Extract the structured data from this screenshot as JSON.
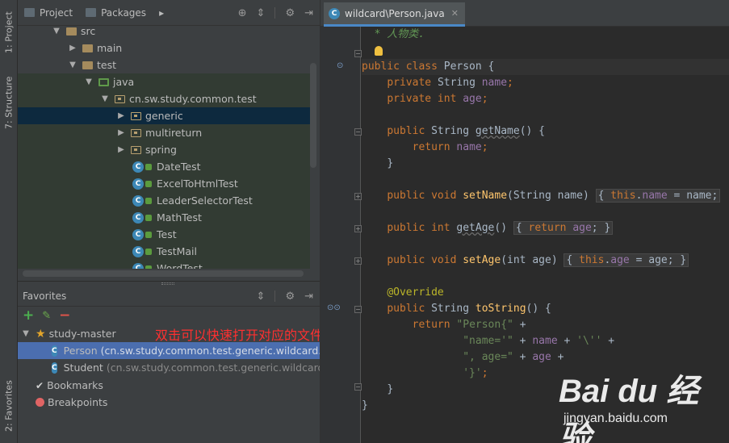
{
  "left_strip": {
    "project_tab": "1: Project",
    "structure_tab": "7: Structure",
    "favorites_tab": "2: Favorites"
  },
  "project_panel": {
    "tabs": [
      "Project",
      "Packages"
    ],
    "tree": [
      {
        "label": "src",
        "kind": "folder",
        "expanded": true
      },
      {
        "label": "main",
        "kind": "folder",
        "expanded": false
      },
      {
        "label": "test",
        "kind": "folder",
        "expanded": true
      },
      {
        "label": "java",
        "kind": "test-root",
        "expanded": true
      },
      {
        "label": "cn.sw.study.common.test",
        "kind": "package",
        "expanded": true
      },
      {
        "label": "generic",
        "kind": "package",
        "expanded": false
      },
      {
        "label": "multireturn",
        "kind": "package",
        "expanded": false
      },
      {
        "label": "spring",
        "kind": "package",
        "expanded": false
      },
      {
        "label": "DateTest",
        "kind": "class"
      },
      {
        "label": "ExcelToHtmlTest",
        "kind": "class"
      },
      {
        "label": "LeaderSelectorTest",
        "kind": "class"
      },
      {
        "label": "MathTest",
        "kind": "class"
      },
      {
        "label": "Test",
        "kind": "class"
      },
      {
        "label": "TestMail",
        "kind": "class"
      },
      {
        "label": "WordTest",
        "kind": "class"
      }
    ]
  },
  "favorites": {
    "title": "Favorites",
    "list_name": "study-master",
    "items": [
      {
        "name": "Person",
        "path": "(cn.sw.study.common.test.generic.wildcard.P"
      },
      {
        "name": "Student",
        "path": "(cn.sw.study.common.test.generic.wildcard."
      }
    ],
    "bookmarks": "Bookmarks",
    "breakpoints": "Breakpoints",
    "annotation": "双击可以快速打开对应的文件"
  },
  "editor": {
    "tab_label": "wildcard\\Person.java",
    "code": {
      "l0": "* 人物类.",
      "l2_kw": "public class ",
      "l2_name": "Person",
      "l2_rest": " {",
      "l3_kw": "private ",
      "l3_type": "String ",
      "l3_field": "name",
      "l3_end": ";",
      "l4_kw": "private int ",
      "l4_field": "age",
      "l4_end": ";",
      "l6_kw": "public ",
      "l6_type": "String ",
      "l6_fn": "getName",
      "l6_rest": "() {",
      "l7_kw": "return ",
      "l7_field": "name",
      "l7_end": ";",
      "l8": "}",
      "l10_kw": "public void ",
      "l10_fn": "setName",
      "l10_rest": "(String name) ",
      "l10_fold_open": "{ ",
      "l10_this": "this",
      "l10_dot": ".",
      "l10_field": "name",
      "l10_tail": " = name;",
      "l12_kw": "public int ",
      "l12_fn": "getAge",
      "l12_rest": "() ",
      "l12_fold_open": "{ ",
      "l12_ret": "return ",
      "l12_field": "age",
      "l12_tail": "; }",
      "l14_kw": "public void ",
      "l14_fn": "setAge",
      "l14_rest": "(int age) ",
      "l14_fold_open": "{ ",
      "l14_this": "this",
      "l14_dot": ".",
      "l14_field": "age",
      "l14_tail": " = age; }",
      "l16": "@Override",
      "l17_kw": "public ",
      "l17_type": "String ",
      "l17_fn": "toString",
      "l17_rest": "() {",
      "l18_kw": "return ",
      "l18_str": "\"Person{\"",
      "l18_plus": " +",
      "l19_str": "\"name='\"",
      "l19_mid": " + ",
      "l19_field": "name",
      "l19_mid2": " + ",
      "l19_chr": "'\\''",
      "l19_plus": " +",
      "l20_str": "\", age=\"",
      "l20_mid": " + ",
      "l20_field": "age",
      "l20_plus": " +",
      "l21_chr": "'}'",
      "l21_end": ";",
      "l22": "}",
      "l23": "}"
    }
  },
  "watermark": {
    "logo": "Bai du 经验",
    "url": "jingyan.baidu.com"
  },
  "colors": {
    "background": "#2b2b2b",
    "panel": "#3c3f41",
    "selection": "#4b6eaf",
    "keyword": "#cc7832",
    "field": "#9876aa",
    "string": "#6a8759",
    "method": "#ffc66d",
    "annotation_red": "#ff3030"
  }
}
